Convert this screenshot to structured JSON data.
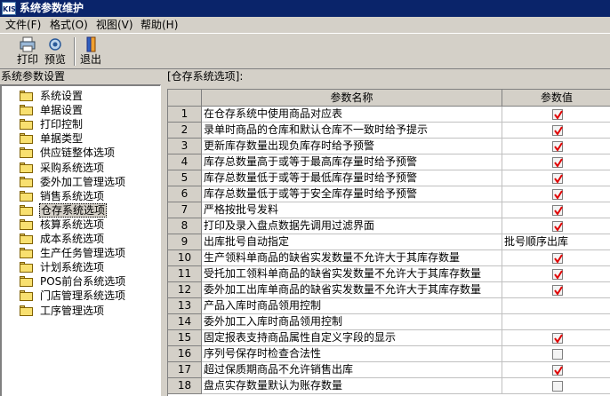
{
  "window": {
    "title": "系统参数维护",
    "icon_text": "KIS"
  },
  "menu": [
    {
      "label": "文件(F)"
    },
    {
      "label": "格式(O)"
    },
    {
      "label": "视图(V)"
    },
    {
      "label": "帮助(H)"
    }
  ],
  "toolbar": {
    "print": "打印",
    "preview": "预览",
    "exit": "退出"
  },
  "left_panel": {
    "title": "系统参数设置"
  },
  "tree": [
    {
      "label": "系统设置"
    },
    {
      "label": "单据设置"
    },
    {
      "label": "打印控制"
    },
    {
      "label": "单据类型"
    },
    {
      "label": "供应链整体选项"
    },
    {
      "label": "采购系统选项"
    },
    {
      "label": "委外加工管理选项"
    },
    {
      "label": "销售系统选项"
    },
    {
      "label": "仓存系统选项",
      "selected": true
    },
    {
      "label": "核算系统选项"
    },
    {
      "label": "成本系统选项"
    },
    {
      "label": "生产任务管理选项"
    },
    {
      "label": "计划系统选项"
    },
    {
      "label": "POS前台系统选项"
    },
    {
      "label": "门店管理系统选项"
    },
    {
      "label": "工序管理选项"
    }
  ],
  "right_panel": {
    "title": "[仓存系统选项]:"
  },
  "grid": {
    "headers": {
      "name": "参数名称",
      "value": "参数值"
    },
    "colors": {
      "check": "#e00000"
    },
    "rows": [
      {
        "num": "1",
        "name": "在仓存系统中使用商品对应表",
        "type": "check",
        "checked": true
      },
      {
        "num": "2",
        "name": "录单时商品的仓库和默认仓库不一致时给予提示",
        "type": "check",
        "checked": true
      },
      {
        "num": "3",
        "name": "更新库存数量出现负库存时给予预警",
        "type": "check",
        "checked": true
      },
      {
        "num": "4",
        "name": "库存总数量高于或等于最高库存量时给予预警",
        "type": "check",
        "checked": true
      },
      {
        "num": "5",
        "name": "库存总数量低于或等于最低库存量时给予预警",
        "type": "check",
        "checked": true
      },
      {
        "num": "6",
        "name": "库存总数量低于或等于安全库存量时给予预警",
        "type": "check",
        "checked": true
      },
      {
        "num": "7",
        "name": "严格按批号发料",
        "type": "check",
        "checked": true
      },
      {
        "num": "8",
        "name": "打印及录入盘点数据先调用过滤界面",
        "type": "check",
        "checked": true
      },
      {
        "num": "9",
        "name": "出库批号自动指定",
        "type": "text",
        "value": "批号顺序出库"
      },
      {
        "num": "10",
        "name": "生产领料单商品的缺省实发数量不允许大于其库存数量",
        "type": "check",
        "checked": true
      },
      {
        "num": "11",
        "name": "受托加工领料单商品的缺省实发数量不允许大于其库存数量",
        "type": "check",
        "checked": true
      },
      {
        "num": "12",
        "name": "委外加工出库单商品的缺省实发数量不允许大于其库存数量",
        "type": "check",
        "checked": true
      },
      {
        "num": "13",
        "name": "产品入库时商品领用控制",
        "type": "text",
        "value": ""
      },
      {
        "num": "14",
        "name": "委外加工入库时商品领用控制",
        "type": "text",
        "value": ""
      },
      {
        "num": "15",
        "name": "固定报表支持商品属性自定义字段的显示",
        "type": "check",
        "checked": true
      },
      {
        "num": "16",
        "name": "序列号保存时检查合法性",
        "type": "check",
        "checked": false
      },
      {
        "num": "17",
        "name": "超过保质期商品不允许销售出库",
        "type": "check",
        "checked": true
      },
      {
        "num": "18",
        "name": "盘点实存数量默认为账存数量",
        "type": "check",
        "checked": false
      }
    ]
  }
}
